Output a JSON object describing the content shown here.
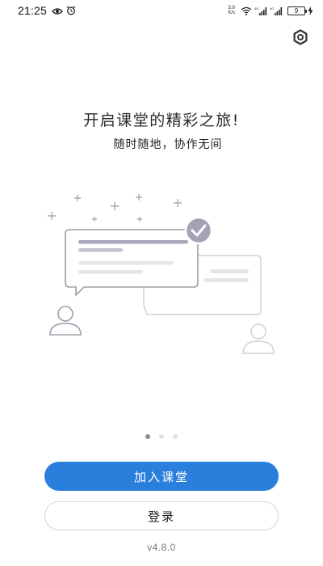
{
  "status_bar": {
    "time": "21:25",
    "net_speed_value": "3.9",
    "net_speed_unit": "K/s",
    "battery": "9",
    "icons": [
      "eye-icon",
      "alarm-icon",
      "wifi-icon",
      "signal-icon",
      "signal-icon",
      "battery-icon",
      "charging-icon"
    ]
  },
  "settings": {
    "icon": "gear-icon"
  },
  "hero": {
    "headline": "开启课堂的精彩之旅!",
    "subheadline": "随时随地，协作无间"
  },
  "pager": {
    "count": 3,
    "active_index": 0
  },
  "buttons": {
    "join_class": "加入课堂",
    "login": "登录"
  },
  "version": "v4.8.0",
  "colors": {
    "primary": "#2a7fdc",
    "accent_card": "#a8a7ba",
    "check_badge": "#a4a3b6"
  }
}
